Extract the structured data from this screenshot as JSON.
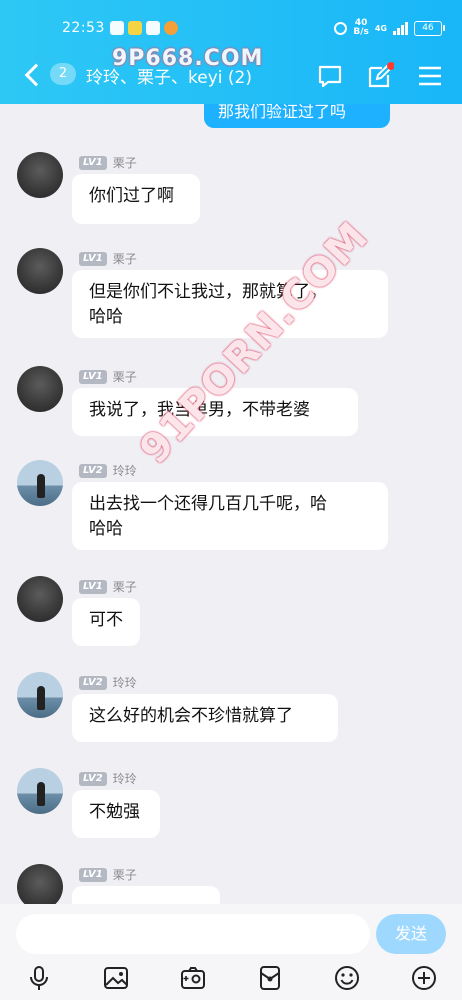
{
  "status": {
    "time": "22:53",
    "netspeed_value": "40",
    "netspeed_unit": "B/s",
    "network": "4G",
    "battery": "46"
  },
  "header": {
    "unread": "2",
    "title": "玲玲、栗子、keyi (2)"
  },
  "watermarks": {
    "top": "9P668.COM",
    "diagonal": "91PORN.COM"
  },
  "sent_partial": "那我们验证过了吗",
  "messages": [
    {
      "avatar": "dark",
      "level": "LV1",
      "name": "栗子",
      "lines": [
        "你们过了啊"
      ]
    },
    {
      "avatar": "dark",
      "level": "LV1",
      "name": "栗子",
      "lines": [
        "但是你们不让我过，那就算了，",
        "哈哈"
      ]
    },
    {
      "avatar": "dark",
      "level": "LV1",
      "name": "栗子",
      "lines": [
        "我说了，我当单男，不带老婆"
      ]
    },
    {
      "avatar": "sea",
      "level": "LV2",
      "name": "玲玲",
      "lines": [
        "出去找一个还得几百几千呢，哈",
        "哈哈"
      ]
    },
    {
      "avatar": "dark",
      "level": "LV1",
      "name": "栗子",
      "lines": [
        "可不"
      ]
    },
    {
      "avatar": "sea",
      "level": "LV2",
      "name": "玲玲",
      "lines": [
        "这么好的机会不珍惜就算了"
      ]
    },
    {
      "avatar": "sea",
      "level": "LV2",
      "name": "玲玲",
      "lines": [
        "不勉强"
      ]
    },
    {
      "avatar": "dark",
      "level": "LV1",
      "name": "栗子",
      "lines": [
        ""
      ]
    }
  ],
  "input": {
    "placeholder": "",
    "send_label": "发送"
  },
  "toolbar_icons": [
    "mic-icon",
    "image-icon",
    "camera-icon",
    "red-packet-icon",
    "emoji-icon",
    "plus-icon"
  ],
  "colors": {
    "header": "#19b6f8",
    "sent_bubble": "#1eb1ff",
    "send_button": "#9fd8ff",
    "background": "#efeff4"
  }
}
